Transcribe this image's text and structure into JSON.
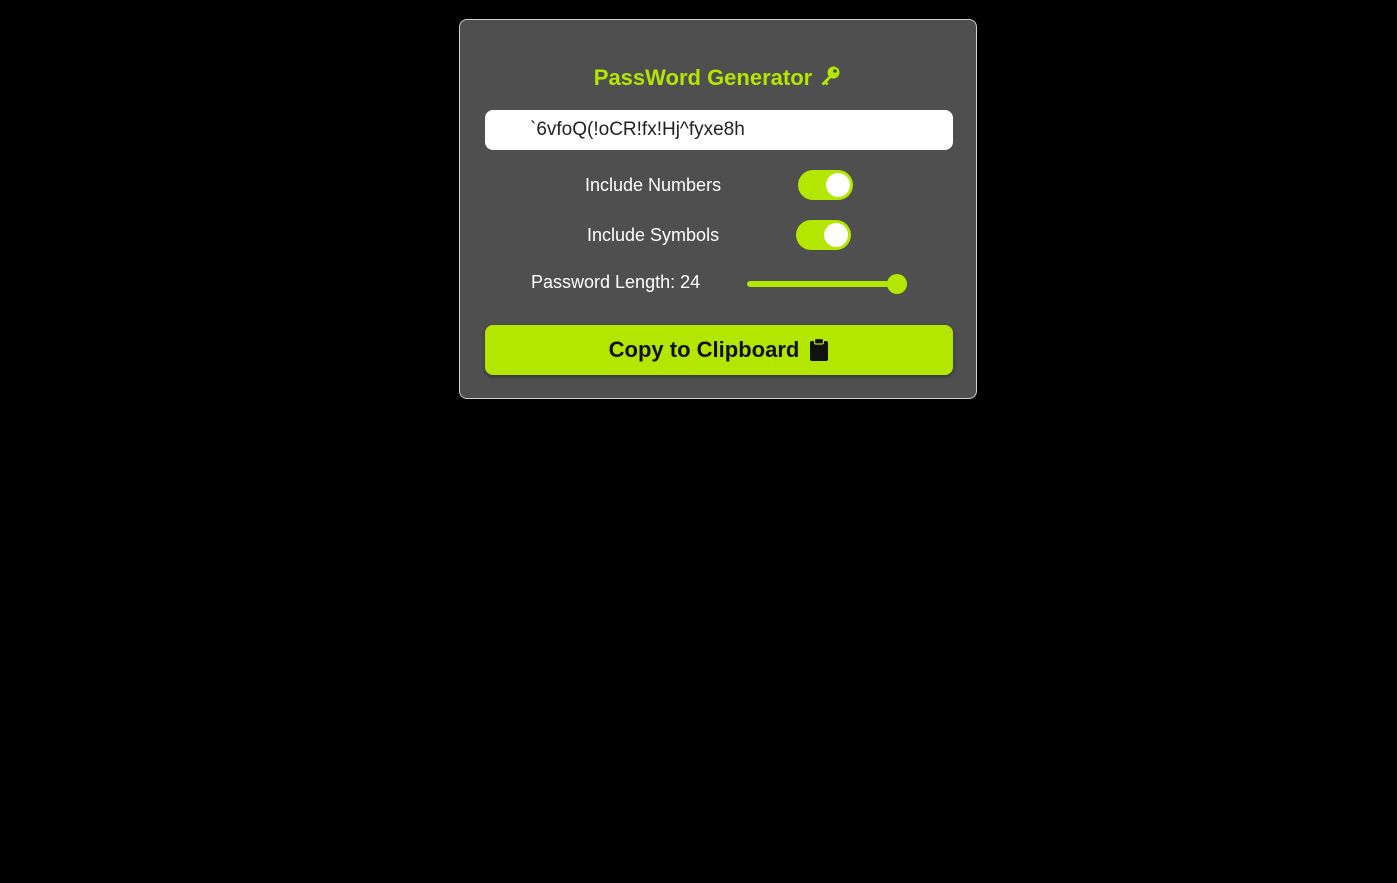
{
  "app": {
    "title": "PassWord Generator",
    "title_icon": "key-icon"
  },
  "password": {
    "value": "`6vfoQ(!oCR!fx!Hj^fyxe8h"
  },
  "options": {
    "numbers": {
      "label": "Include Numbers",
      "enabled": true
    },
    "symbols": {
      "label": "Include Symbols",
      "enabled": true
    }
  },
  "length": {
    "label": "Password Length: 24",
    "value": 24,
    "slider_fraction": 0.94
  },
  "copy_button": {
    "label": "Copy to Clipboard",
    "icon": "clipboard-icon"
  },
  "colors": {
    "background": "#000000",
    "card": "#4f4f4f",
    "accent": "#b3e600",
    "text": "#ffffff"
  }
}
